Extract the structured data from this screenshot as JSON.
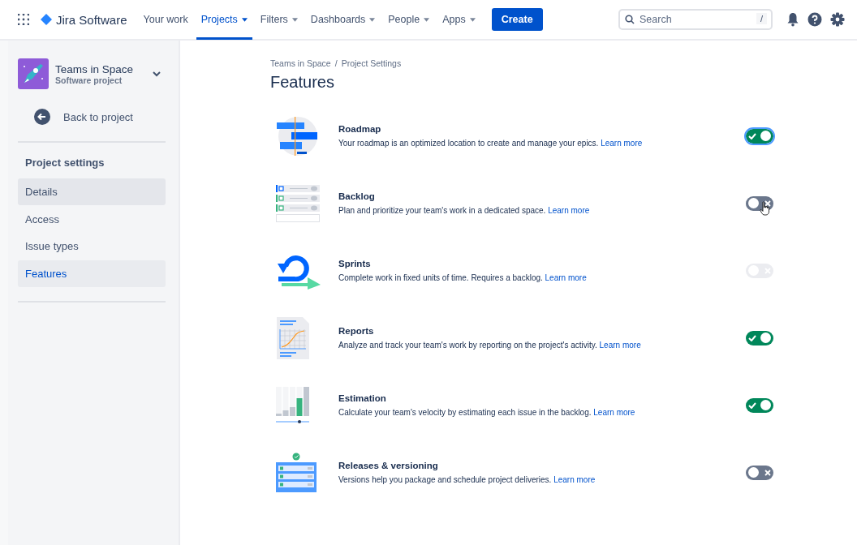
{
  "top_nav": {
    "product": "Jira Software",
    "items": [
      {
        "label": "Your work",
        "has_menu": false,
        "selected": false
      },
      {
        "label": "Projects",
        "has_menu": true,
        "selected": true
      },
      {
        "label": "Filters",
        "has_menu": true,
        "selected": false
      },
      {
        "label": "Dashboards",
        "has_menu": true,
        "selected": false
      },
      {
        "label": "People",
        "has_menu": true,
        "selected": false
      },
      {
        "label": "Apps",
        "has_menu": true,
        "selected": false
      }
    ],
    "create_button": "Create",
    "search": {
      "placeholder": "Search",
      "shortcut": "/"
    }
  },
  "sidebar": {
    "project_name": "Teams in Space",
    "project_type": "Software project",
    "back_link": "Back to project",
    "section_title": "Project settings",
    "items": [
      {
        "label": "Details",
        "selected": false,
        "hovered": true
      },
      {
        "label": "Access",
        "selected": false,
        "hovered": false
      },
      {
        "label": "Issue types",
        "selected": false,
        "hovered": false
      },
      {
        "label": "Features",
        "selected": true,
        "hovered": false
      }
    ]
  },
  "breadcrumbs": [
    "Teams in Space",
    "Project Settings"
  ],
  "breadcrumb_separator": "/",
  "page_title": "Features",
  "features": [
    {
      "kind": "roadmap",
      "title": "Roadmap",
      "description": "Your roadmap is an optimized location to create and manage your epics.",
      "link": "Learn more",
      "on": true,
      "disabled": false,
      "focused": true
    },
    {
      "kind": "backlog",
      "title": "Backlog",
      "description": "Plan and prioritize your team's work in a dedicated space.",
      "link": "Learn more",
      "on": false,
      "disabled": false,
      "pointer_cursor": true
    },
    {
      "kind": "sprints",
      "title": "Sprints",
      "description": "Complete work in fixed units of time. Requires a backlog.",
      "link": "Learn more",
      "on": false,
      "disabled": true
    },
    {
      "kind": "reports",
      "title": "Reports",
      "description": "Analyze and track your team's work by reporting on the project's activity.",
      "link": "Learn more",
      "on": true,
      "disabled": false
    },
    {
      "kind": "estimation",
      "title": "Estimation",
      "description": "Calculate your team's velocity by estimating each issue in the backlog.",
      "link": "Learn more",
      "on": true,
      "disabled": false
    },
    {
      "kind": "releases",
      "title": "Releases & versioning",
      "description": "Versions help you package and schedule project deliveries.",
      "link": "Learn more",
      "on": false,
      "disabled": false
    }
  ]
}
